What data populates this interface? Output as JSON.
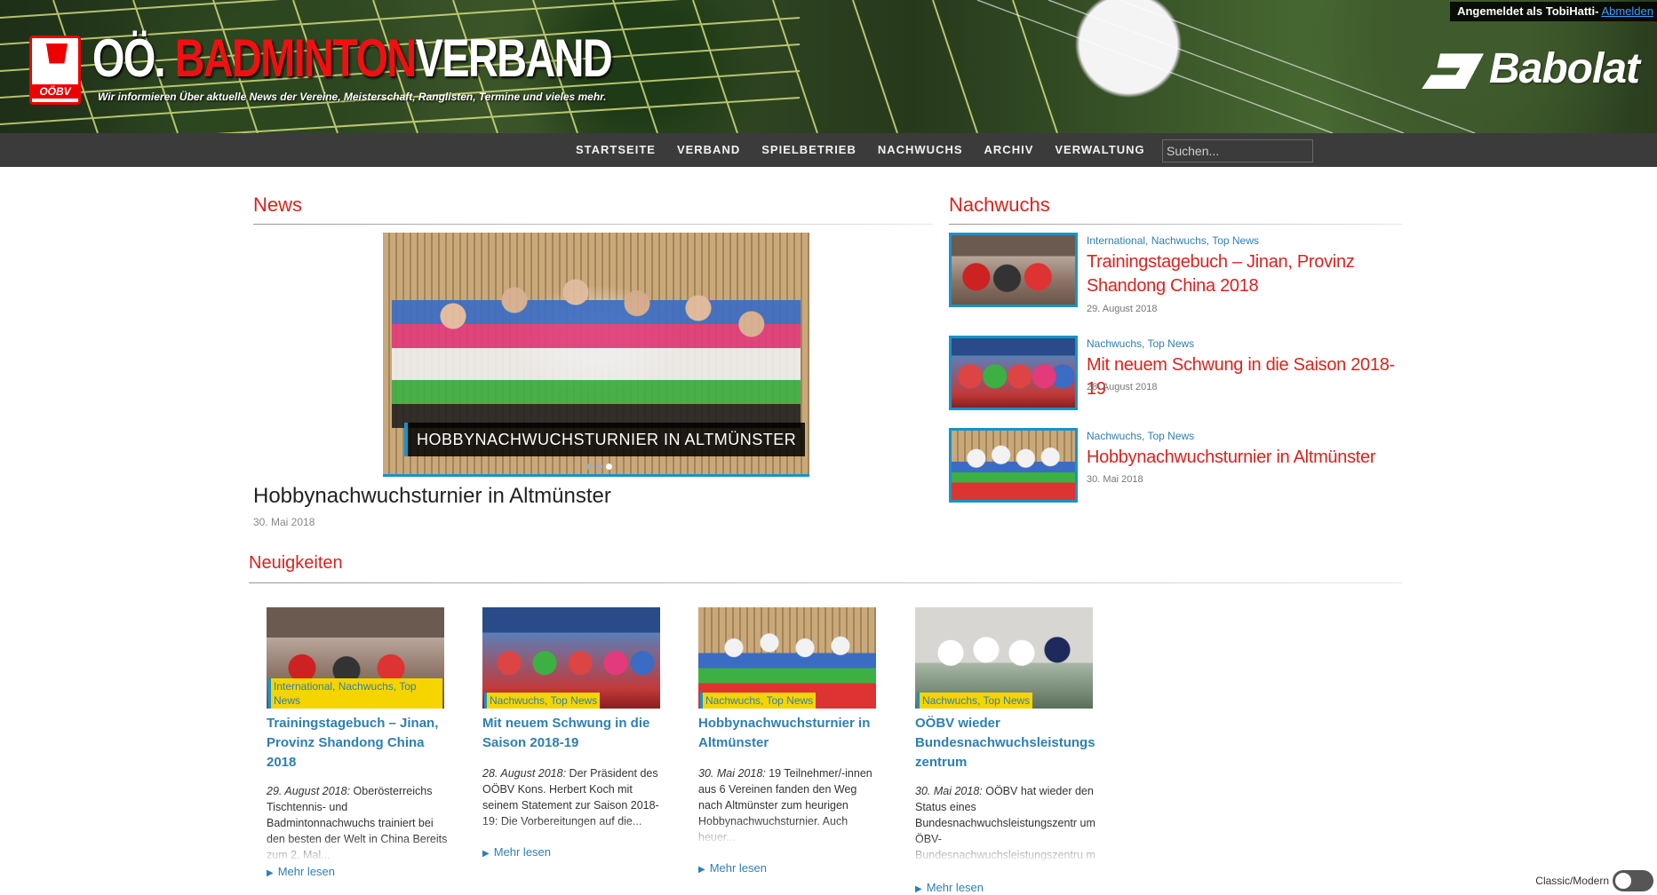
{
  "header": {
    "logo_abbr": "OÖBV",
    "title_part1": "OÖ.",
    "title_part2": "BADMINTON",
    "title_part3": "VERBAND",
    "subtitle": "Wir informieren Über aktuelle News der Vereine, Meisterschaft, Ranglisten, Termine und vieles mehr.",
    "login_text": "Angemeldet als TobiHatti-",
    "logout_label": "Abmelden",
    "sponsor": "Babolat"
  },
  "nav": {
    "items": [
      "STARTSEITE",
      "VERBAND",
      "SPIELBETRIEB",
      "NACHWUCHS",
      "ARCHIV",
      "VERWALTUNG"
    ],
    "search_placeholder": "Suchen..."
  },
  "news": {
    "heading": "News",
    "slide_caption": "HOBBYNACHWUCHSTURNIER IN ALTMÜNSTER",
    "slide_count": 3,
    "active_slide": 3,
    "headline": "Hobbynachwuchsturnier in Altmünster",
    "date": "30. Mai 2018"
  },
  "nachwuchs": {
    "heading": "Nachwuchs",
    "items": [
      {
        "tags": "International,  Nachwuchs,  Top News",
        "title": "Trainingstagebuch – Jinan, Provinz Shandong China 2018",
        "date": "29. August 2018"
      },
      {
        "tags": "Nachwuchs,  Top News",
        "title": "Mit neuem Schwung in die Saison 2018-19",
        "date": "28. August 2018"
      },
      {
        "tags": "Nachwuchs,  Top News",
        "title": "Hobbynachwuchsturnier in Altmünster",
        "date": "30. Mai 2018"
      }
    ]
  },
  "neuigkeiten": {
    "heading": "Neuigkeiten",
    "more_label": "Mehr lesen",
    "cards": [
      {
        "tags": "International,  Nachwuchs,  Top News",
        "title": "Trainingstagebuch – Jinan, Provinz Shandong China 2018",
        "date": "29. August 2018:",
        "excerpt": "Oberösterreichs Tischtennis- und Badmintonnachwuchs  trainiert bei den besten der Welt in China Bereits zum 2. Mal..."
      },
      {
        "tags": "Nachwuchs,  Top News",
        "title": "Mit neuem Schwung in die Saison 2018-19",
        "date": "28. August 2018:",
        "excerpt": "Der Präsident des OÖBV Kons. Herbert Koch mit seinem  Statement zur Saison 2018-19: Die Vorbereitungen auf die..."
      },
      {
        "tags": "Nachwuchs,  Top News",
        "title": "Hobbynachwuchsturnier in Altmünster",
        "date": "30. Mai 2018:",
        "excerpt": "19 Teilnehmer/-innen aus 6 Vereinen fanden den Weg nach Altmünster zum heurigen Hobbynachwuchsturnier.  Auch heuer..."
      },
      {
        "tags": "Nachwuchs,  Top News",
        "title": "OÖBV wieder Bundesnachwuchsleistungs zentrum",
        "date": "30. Mai 2018:",
        "excerpt": "OÖBV hat wieder den Status eines Bundesnachwuchsleistungszentr um ÖBV-Bundesnachwuchsleistungszentru m – Nord Der..."
      }
    ]
  },
  "style_toggle": {
    "label": "Classic/Modern"
  }
}
